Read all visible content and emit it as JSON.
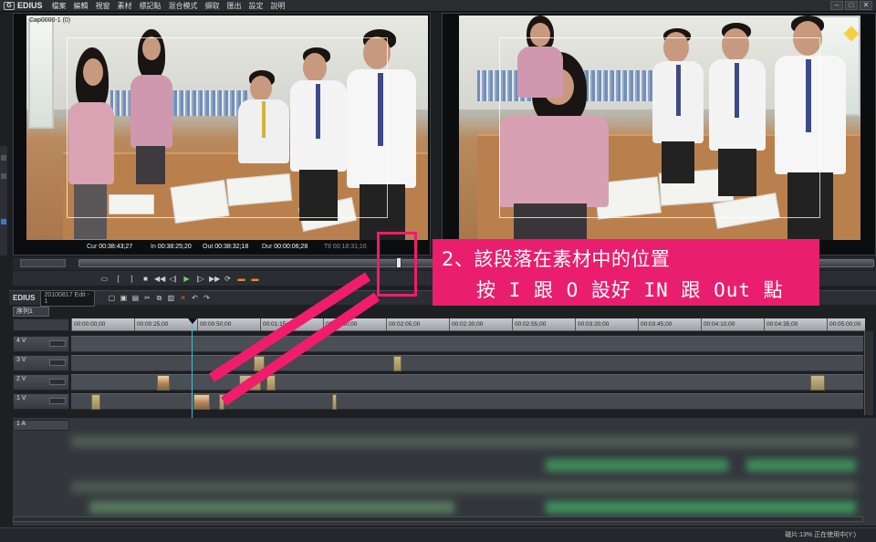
{
  "app": {
    "logo_text": "EDIUS",
    "menu": [
      "檔案",
      "編輯",
      "視窗",
      "素材",
      "標記點",
      "混合模式",
      "擷取",
      "匯出",
      "設定",
      "說明"
    ]
  },
  "player": {
    "label": "Cap0000-1 (0)",
    "cur_label": "Cur",
    "cur_value": "00:38:43;27",
    "in_label": "In",
    "in_value": "00:38:25;20",
    "out_label": "Out",
    "out_value": "00:38:32;18",
    "dur_label": "Dur",
    "dur_value": "00:00:06;28",
    "ttl_label": "Ttl",
    "ttl_value": "00:18:31;16"
  },
  "timeline": {
    "app_label": "EDIUS",
    "project_name": "20100817 Edit - 1",
    "sequence_tab": "序列1",
    "ruler_ticks": [
      "00:00:00;00",
      "00:00:25;00",
      "00:00:50;00",
      "00:01:15;00",
      "00:01:40;00",
      "00:02:05;00",
      "00:02:30;00",
      "00:02:55;00",
      "00:03:20;00",
      "00:03:45;00",
      "00:04:10;00",
      "00:04:35;00",
      "00:05:00;00"
    ],
    "tracks": [
      {
        "label": "4 V",
        "sub": "B"
      },
      {
        "label": "3 V",
        "sub": "B"
      },
      {
        "label": "2 V",
        "sub": "B"
      },
      {
        "label": "1 V",
        "sub": "B"
      }
    ],
    "audio_track_label": "1 A"
  },
  "status": {
    "text": "磁片:13% 正在使用中(Y:)"
  },
  "annotation": {
    "line1": "2、該段落在素材中的位置",
    "line2": "按 I 跟 O 設好 IN 跟 Out 點",
    "color": "#e91e6e"
  }
}
